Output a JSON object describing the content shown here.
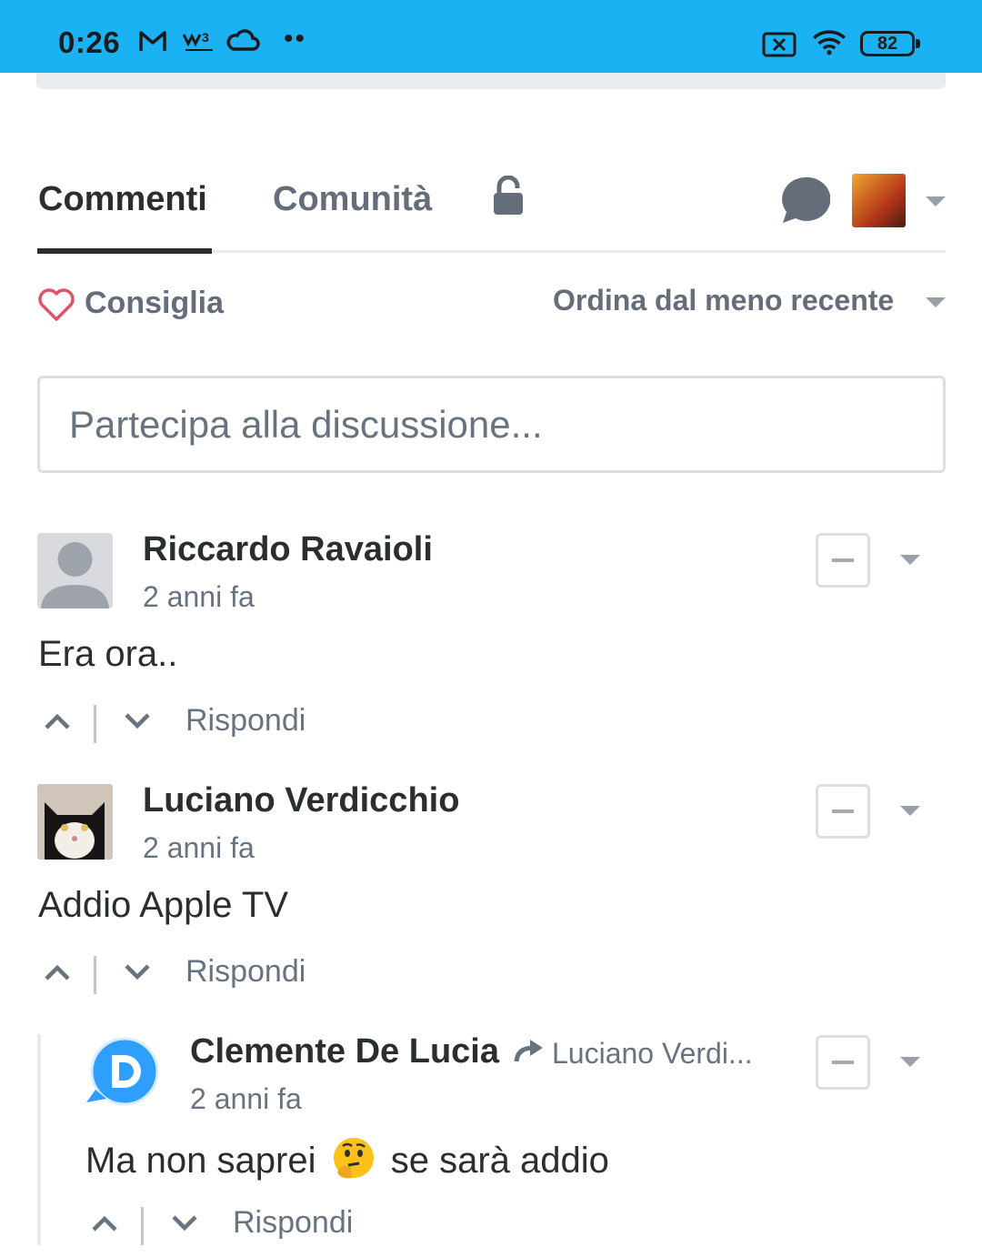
{
  "status_bar": {
    "time": "0:26",
    "battery": "82"
  },
  "tabs": {
    "comments": "Commenti",
    "community": "Comunità"
  },
  "toolbar": {
    "recommend": "Consiglia",
    "sort": "Ordina dal meno recente"
  },
  "composer": {
    "placeholder": "Partecipa alla discussione..."
  },
  "comments": [
    {
      "author": "Riccardo Ravaioli",
      "time": "2 anni fa",
      "text": "Era ora..",
      "reply": "Rispondi"
    },
    {
      "author": "Luciano Verdicchio",
      "time": "2 anni fa",
      "text": "Addio Apple TV",
      "reply": "Rispondi"
    },
    {
      "author": "Clemente De Lucia",
      "reply_to": "Luciano Verdi...",
      "time": "2 anni fa",
      "text_before": "Ma non saprei",
      "emoji": "🤔",
      "text_after": "se sarà addio",
      "reply": "Rispondi"
    }
  ],
  "colors": {
    "status_bar": "#1ab2f3",
    "text_primary": "#2a2e2e",
    "text_secondary": "#687380",
    "heart": "#e05265"
  }
}
